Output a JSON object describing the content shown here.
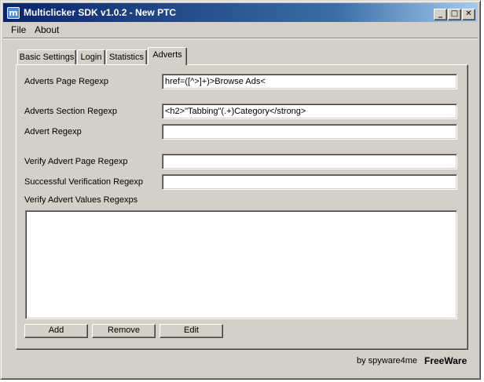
{
  "window": {
    "title": "Multiclicker SDK v1.0.2 - New PTC",
    "app_icon_glyph": "m",
    "controls": {
      "minimize": "_",
      "maximize": "□",
      "close": "✕"
    }
  },
  "menu": {
    "items": [
      "File",
      "About"
    ]
  },
  "tabs": [
    "Basic Settings",
    "Login",
    "Statistics",
    "Adverts"
  ],
  "active_tab": "Adverts",
  "adverts": {
    "page_regexp_label": "Adverts Page Regexp",
    "page_regexp_value": "href=([^>]+)>Browse Ads<",
    "section_regexp_label": "Adverts Section Regexp",
    "section_regexp_value": "<h2>\"Tabbing\"(.+)Category</strong>",
    "advert_regexp_label": "Advert Regexp",
    "advert_regexp_value": "",
    "verify_page_label": "Verify Advert Page Regexp",
    "verify_page_value": "",
    "success_label": "Successful Verification Regexp",
    "success_value": "",
    "values_label": "Verify Advert Values Regexps",
    "values_text": "",
    "buttons": {
      "add": "Add",
      "remove": "Remove",
      "edit": "Edit"
    }
  },
  "footer": {
    "credit": "by spyware4me",
    "license": "FreeWare"
  },
  "colors": {
    "titlebar_start": "#0a246a",
    "titlebar_end": "#a6caf0",
    "face": "#d4d0c8"
  }
}
